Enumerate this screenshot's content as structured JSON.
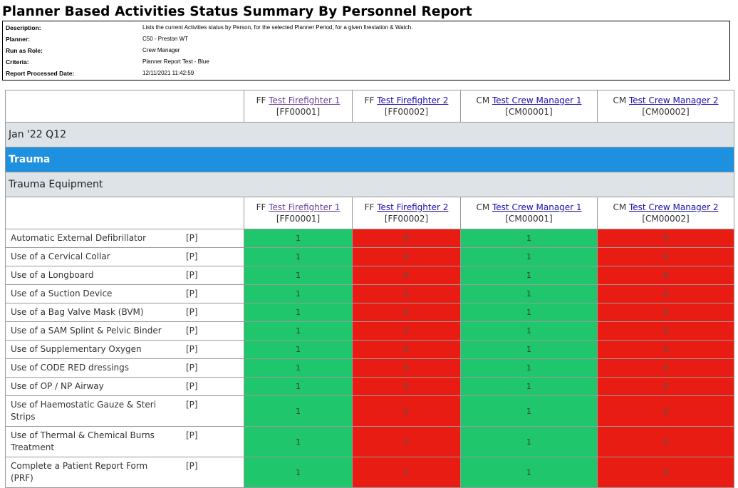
{
  "report": {
    "title": "Planner Based Activities Status Summary By Personnel Report",
    "info": [
      {
        "label": "Description:",
        "value": "Lists the current Activities status by Person, for the selected Planner Period, for a given firestation & Watch."
      },
      {
        "label": "Planner:",
        "value": "C50 - Preston WT"
      },
      {
        "label": "Run as Role:",
        "value": "Crew Manager"
      },
      {
        "label": "Criteria:",
        "value": "Planner Report Test - Blue"
      },
      {
        "label": "Report Processed Date:",
        "value": "12/11/2021 11:42:59"
      }
    ]
  },
  "personnel": [
    {
      "prefix": "FF",
      "name": "Test Firefighter 1",
      "code": "[FF00001]"
    },
    {
      "prefix": "FF",
      "name": "Test Firefighter 2",
      "code": "[FF00002]"
    },
    {
      "prefix": "CM",
      "name": "Test Crew Manager 1",
      "code": "[CM00001]"
    },
    {
      "prefix": "CM",
      "name": "Test Crew Manager 2",
      "code": "[CM00002]"
    }
  ],
  "period": "Jan '22 Q12",
  "category": "Trauma",
  "subcategory": "Trauma Equipment",
  "activities": [
    {
      "name": "Automatic External Defibrillator",
      "tag": "[P]",
      "values": [
        "1",
        "0",
        "1",
        "0"
      ]
    },
    {
      "name": "Use of a Cervical Collar",
      "tag": "[P]",
      "values": [
        "1",
        "0",
        "1",
        "0"
      ]
    },
    {
      "name": "Use of a Longboard",
      "tag": "[P]",
      "values": [
        "1",
        "0",
        "1",
        "0"
      ]
    },
    {
      "name": "Use of a Suction Device",
      "tag": "[P]",
      "values": [
        "1",
        "0",
        "1",
        "0"
      ]
    },
    {
      "name": "Use of a Bag Valve Mask (BVM)",
      "tag": "[P]",
      "values": [
        "1",
        "0",
        "1",
        "0"
      ]
    },
    {
      "name": "Use of a SAM Splint & Pelvic Binder",
      "tag": "[P]",
      "values": [
        "1",
        "0",
        "1",
        "0"
      ]
    },
    {
      "name": "Use of Supplementary Oxygen",
      "tag": "[P]",
      "values": [
        "1",
        "0",
        "1",
        "0"
      ]
    },
    {
      "name": "Use of CODE RED dressings",
      "tag": "[P]",
      "values": [
        "1",
        "0",
        "1",
        "0"
      ]
    },
    {
      "name": "Use of OP / NP Airway",
      "tag": "[P]",
      "values": [
        "1",
        "0",
        "1",
        "0"
      ]
    },
    {
      "name": "Use of Haemostatic Gauze & Steri Strips",
      "tag": "[P]",
      "values": [
        "1",
        "0",
        "1",
        "0"
      ]
    },
    {
      "name": "Use of Thermal & Chemical Burns Treatment",
      "tag": "[P]",
      "values": [
        "1",
        "0",
        "1",
        "0"
      ]
    },
    {
      "name": "Complete a Patient Report Form (PRF)",
      "tag": "[P]",
      "values": [
        "1",
        "0",
        "1",
        "0"
      ]
    }
  ],
  "colors": {
    "complete": "#1fc66b",
    "incomplete": "#e81c12",
    "category": "#1e90e0",
    "section": "#dde3e6"
  }
}
